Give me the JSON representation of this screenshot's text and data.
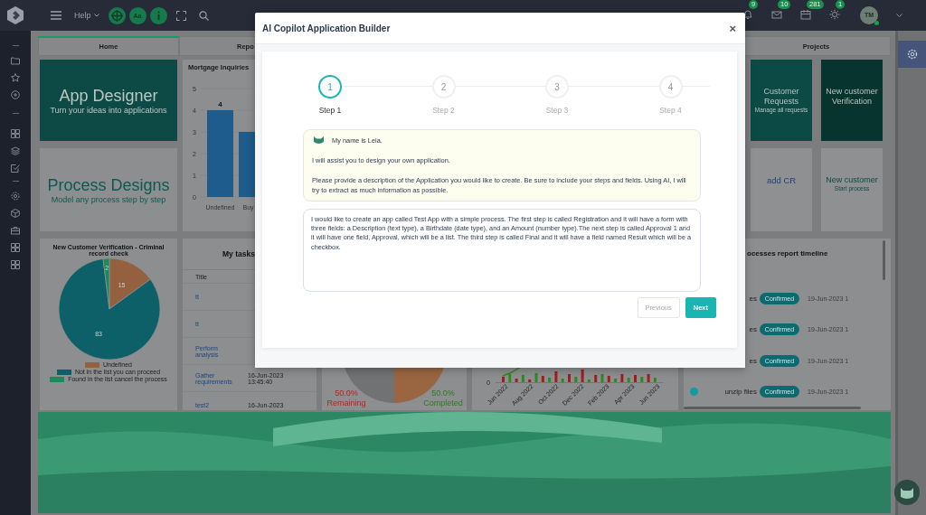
{
  "topbar": {
    "help": "Help",
    "font_button": "Aa",
    "badges": [
      "9",
      "10",
      "281",
      "1"
    ],
    "user": {
      "initials": "TM",
      "online": true
    }
  },
  "tabs": [
    {
      "label": "Home",
      "selected": true
    },
    {
      "label": "Repo",
      "selected": false
    },
    {
      "label": "Projects",
      "selected": false
    }
  ],
  "dashboard": {
    "app_designer": {
      "title": "App Designer",
      "subtitle": "Turn your ideas into applications"
    },
    "process_designs": {
      "title": "Process Designs",
      "subtitle": "Model any process step by step"
    },
    "mortgage": {
      "title": "Mortgage Inquiries",
      "chart_data": {
        "type": "bar",
        "categories": [
          "Undefined",
          "Buy"
        ],
        "values": [
          4,
          3
        ],
        "ylim": [
          0,
          5
        ],
        "yticks": [
          0,
          1,
          2,
          3,
          4,
          5
        ],
        "annotations": [
          {
            "x": "Undefined",
            "y": 4,
            "text": "4"
          }
        ]
      }
    },
    "tiles": [
      {
        "kind": "dark",
        "title": "Customer Requests",
        "subtitle": "Manage all requests"
      },
      {
        "kind": "darker",
        "title": "New customer Verification"
      },
      {
        "kind": "link",
        "title": "add CR"
      },
      {
        "kind": "plain",
        "title": "New customer",
        "subtitle": "Start process"
      }
    ],
    "criminal_check": {
      "chart_data": {
        "type": "pie",
        "title": "New Customer Verification - Criminal record check",
        "categories": [
          "Undefined",
          "Not in the list you can proceed",
          "Found in the list cancel the process"
        ],
        "values": [
          15,
          83,
          2
        ],
        "colors": [
          "#94603f",
          "#0d5f68",
          "#1b8a5c"
        ],
        "data_labels": true
      }
    },
    "tasks": {
      "title": "My tasks",
      "column": "Title",
      "rows": [
        {
          "title": "tt"
        },
        {
          "title": "tt"
        },
        {
          "title": "Perform analysis"
        },
        {
          "title": "Gather requirements",
          "date": "16-Jun-2023 13:45:40"
        },
        {
          "title": "test2",
          "date": "16-Jun-2023"
        }
      ]
    },
    "progress": {
      "chart_data": {
        "type": "pie",
        "categories": [
          "Remaining",
          "Completed"
        ],
        "values": [
          50,
          50
        ],
        "colors": [
          "#707274",
          "#9a6642"
        ],
        "value_labels": [
          "50.0%",
          "50.0%"
        ]
      }
    },
    "monthly": {
      "y_tick": "0",
      "x_labels": [
        "Jun 2022",
        "Aug 2022",
        "Oct 2022",
        "Dec 2022",
        "Feb 2023",
        "Apr 2023",
        "Jun 2023"
      ]
    },
    "timeline": {
      "title": "ocesses report timeline",
      "rows": [
        {
          "name": "es",
          "status": "Confirmed",
          "time": "19-Jun-2023 1",
          "marker": false
        },
        {
          "name": "es",
          "status": "Confirmed",
          "time": "19-Jun-2023 1",
          "marker": false
        },
        {
          "name": "es",
          "status": "Confirmed",
          "time": "19-Jun-2023 1",
          "marker": false
        },
        {
          "name": "unzip files",
          "status": "Confirmed",
          "time": "19-Jun-2023 1",
          "marker": true
        }
      ]
    }
  },
  "modal": {
    "title": "AI Copilot Application Builder",
    "close": "×",
    "steps": [
      {
        "number": "1",
        "label": "Step 1",
        "selected": true
      },
      {
        "number": "2",
        "label": "Step 2",
        "selected": false
      },
      {
        "number": "3",
        "label": "Step 3",
        "selected": false
      },
      {
        "number": "4",
        "label": "Step 4",
        "selected": false
      }
    ],
    "assistant": {
      "greeting": "My name is Leia.",
      "paragraphs": [
        "I will assist you to design your own application.",
        "Please provide a description of the Application you would like to create. Be sure to include your steps and fields. Using AI, I will try to extract as much information as possible."
      ]
    },
    "prompt": {
      "value": "I would like to create an app called Test App with a simple process. The first step is called Registration and it will have a form with three fields: a Description (text type), a Birthdate (date type), and an Amount (number type).The next step is called Approval 1 and it will have one field, Approval, which will be a list. The third step is called Final and it will have a field named Result which will be a checkbox."
    },
    "buttons": [
      {
        "label": "Previous",
        "kind": "secondary",
        "disabled": true
      },
      {
        "label": "Next",
        "kind": "primary",
        "disabled": false
      }
    ]
  }
}
